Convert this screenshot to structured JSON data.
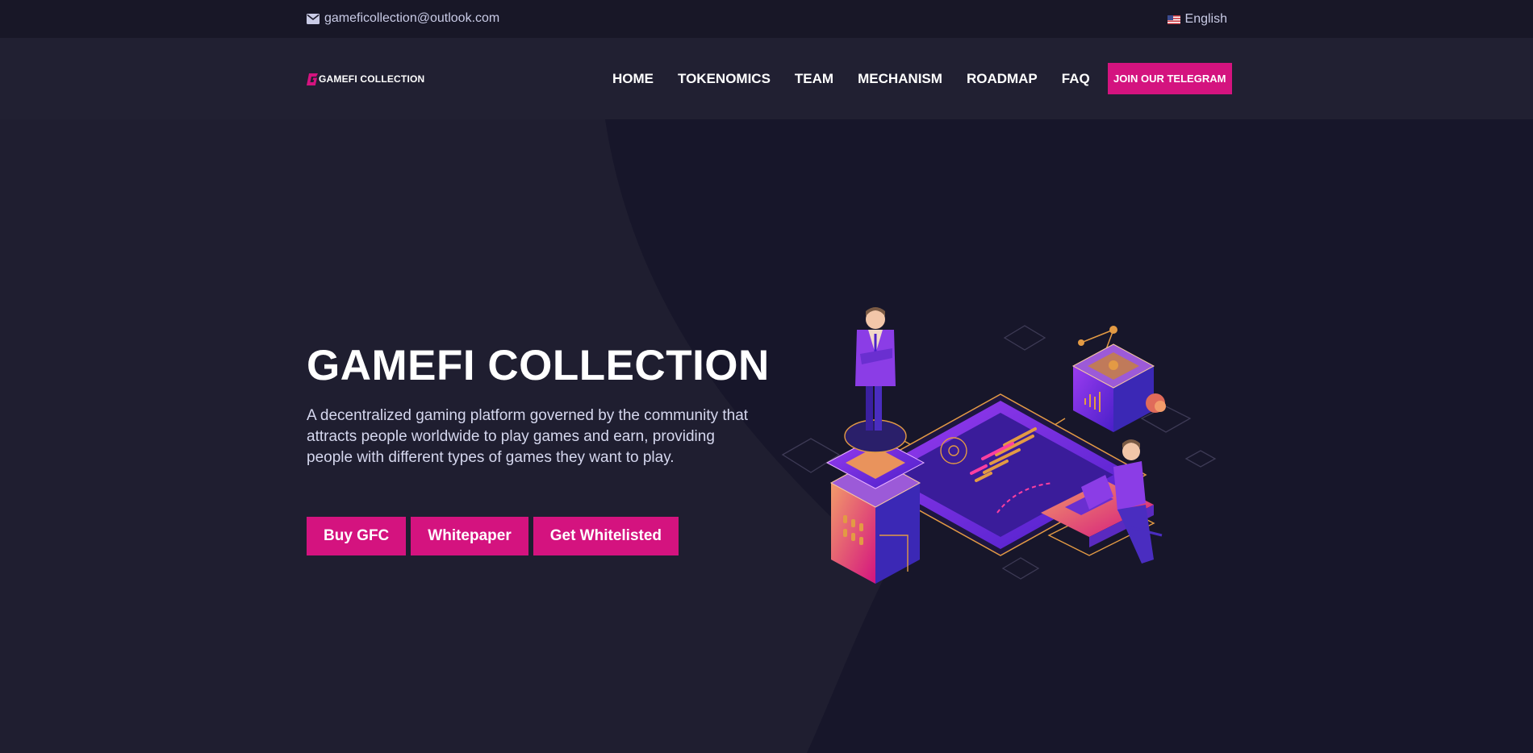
{
  "topbar": {
    "email": "gameficollection@outlook.com",
    "language": "English"
  },
  "header": {
    "logo_text": "GAMEFI COLLECTION",
    "nav": [
      {
        "label": "HOME"
      },
      {
        "label": "TOKENOMICS"
      },
      {
        "label": "TEAM"
      },
      {
        "label": "MECHANISM"
      },
      {
        "label": "ROADMAP"
      },
      {
        "label": "FAQ"
      }
    ],
    "cta_label": "JOIN OUR TELEGRAM"
  },
  "hero": {
    "title": "GAMEFI COLLECTION",
    "description": "A decentralized gaming platform governed by the community that attracts people worldwide to play games and earn, providing people with different types of games they want to play.",
    "buttons": [
      {
        "label": "Buy GFC"
      },
      {
        "label": "Whitepaper"
      },
      {
        "label": "Get Whitelisted"
      }
    ]
  },
  "colors": {
    "accent": "#d4137f",
    "background": "#1f1e30",
    "topbar": "#181727",
    "navbar": "#212032",
    "hero_dark": "#17162a"
  },
  "icons": {
    "email": "envelope-icon",
    "language": "us-flag-icon",
    "logo": "g-logo-icon",
    "illustration": "isometric-gaming-network-illustration"
  }
}
